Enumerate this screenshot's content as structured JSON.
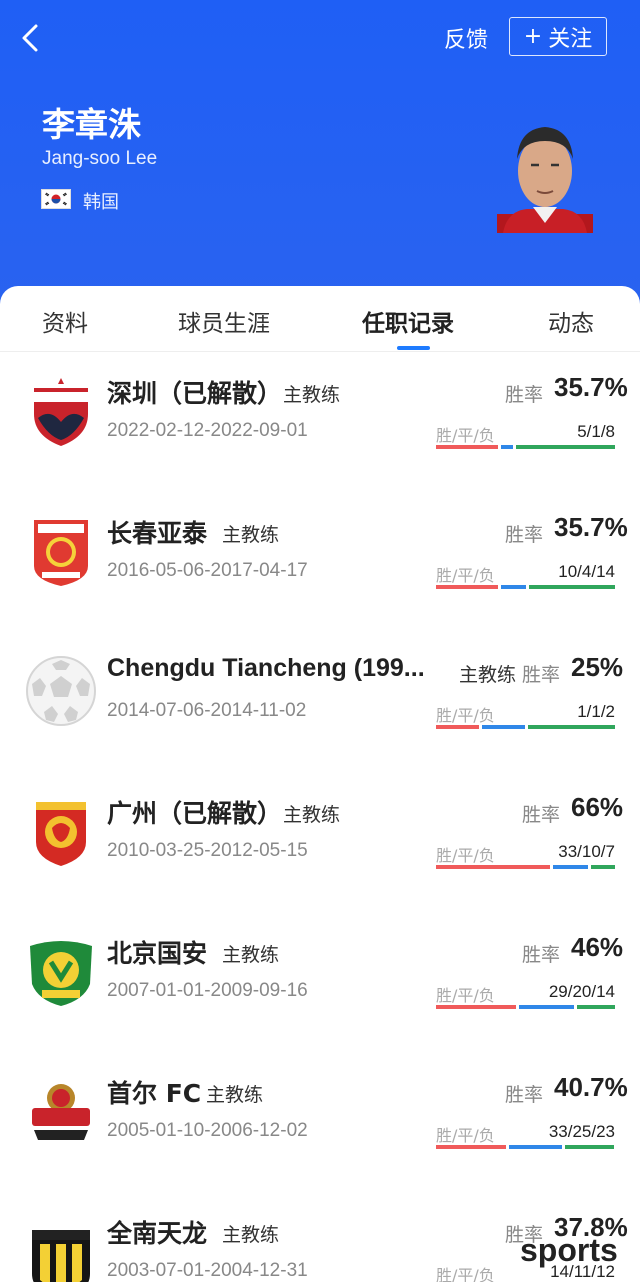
{
  "header": {
    "feedback_label": "反馈",
    "follow_label": "关注",
    "follow_plus": "+",
    "name": "李章洙",
    "english_name": "Jang-soo Lee",
    "country": "韩国",
    "bg_color": "#2563f0"
  },
  "tabs": [
    "资料",
    "球员生涯",
    "任职记录",
    "动态"
  ],
  "active_tab": "任职记录",
  "records": [
    {
      "team": "深圳（已解散）",
      "role": "主教练",
      "dates": "2022-02-12-2022-09-01",
      "rate_label": "胜率",
      "rate": "35.7%",
      "wdl_label": "胜/平/负",
      "record": "5/1/8",
      "wins": 5,
      "draws": 1,
      "losses": 8,
      "logo": "shenzhen-fc-logo"
    },
    {
      "team": "长春亚泰",
      "role": "主教练",
      "dates": "2016-05-06-2017-04-17",
      "rate_label": "胜率",
      "rate": "35.7%",
      "wdl_label": "胜/平/负",
      "record": "10/4/14",
      "wins": 10,
      "draws": 4,
      "losses": 14,
      "logo": "changchun-yatai-logo"
    },
    {
      "team": "Chengdu Tiancheng (199...",
      "role": "主教练",
      "dates": "2014-07-06-2014-11-02",
      "rate_label": "胜率",
      "rate": "25%",
      "wdl_label": "胜/平/负",
      "record": "1/1/2",
      "wins": 1,
      "draws": 1,
      "losses": 2,
      "logo": "generic-football-icon"
    },
    {
      "team": "广州（已解散）",
      "role": "主教练",
      "dates": "2010-03-25-2012-05-15",
      "rate_label": "胜率",
      "rate": "66%",
      "wdl_label": "胜/平/负",
      "record": "33/10/7",
      "wins": 33,
      "draws": 10,
      "losses": 7,
      "logo": "guangzhou-fc-logo"
    },
    {
      "team": "北京国安",
      "role": "主教练",
      "dates": "2007-01-01-2009-09-16",
      "rate_label": "胜率",
      "rate": "46%",
      "wdl_label": "胜/平/负",
      "record": "29/20/14",
      "wins": 29,
      "draws": 20,
      "losses": 14,
      "logo": "beijing-guoan-logo"
    },
    {
      "team": "首尔 FC",
      "role": "主教练",
      "dates": "2005-01-10-2006-12-02",
      "rate_label": "胜率",
      "rate": "40.7%",
      "wdl_label": "胜/平/负",
      "record": "33/25/23",
      "wins": 33,
      "draws": 25,
      "losses": 23,
      "logo": "fc-seoul-logo"
    },
    {
      "team": "全南天龙",
      "role": "主教练",
      "dates": "2003-07-01-2004-12-31",
      "rate_label": "胜率",
      "rate": "37.8%",
      "wdl_label": "胜/平/负",
      "record": "14/11/12",
      "wins": 14,
      "draws": 11,
      "losses": 12,
      "logo": "jeonnam-dragons-logo"
    }
  ],
  "watermark": "sports",
  "colors": {
    "win": "#f05a5a",
    "draw": "#2f87e8",
    "loss": "#30a65c",
    "accent": "#1e7bff"
  }
}
